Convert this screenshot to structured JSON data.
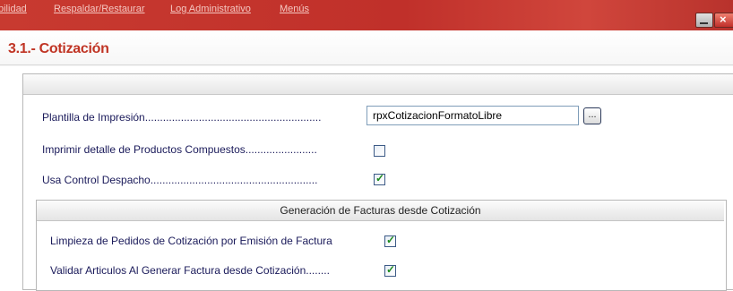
{
  "menubar": {
    "items": [
      "bilidad",
      "Respaldar/Restaurar",
      "Log Administrativo",
      "Menús"
    ]
  },
  "window": {
    "close_glyph": "×"
  },
  "page": {
    "title": "3.1.- Cotización"
  },
  "settings": {
    "plantilla_label": "Plantilla de Impresión...........................................................",
    "plantilla_value": "rpxCotizacionFormatoLibre",
    "browse_label": "...",
    "detalle_label": "Imprimir detalle de Productos Compuestos........................",
    "detalle_checked": false,
    "despacho_label": "Usa Control Despacho........................................................",
    "despacho_checked": true
  },
  "facturas_group": {
    "title": "Generación de Facturas desde Cotización",
    "limpieza_label": "Limpieza de Pedidos de Cotización por Emisión de Factura",
    "limpieza_checked": true,
    "validar_label": "Validar Articulos Al Generar Factura desde Cotización........",
    "validar_checked": true
  },
  "colors": {
    "accent": "#c03424",
    "check": "#1d8a1d"
  }
}
